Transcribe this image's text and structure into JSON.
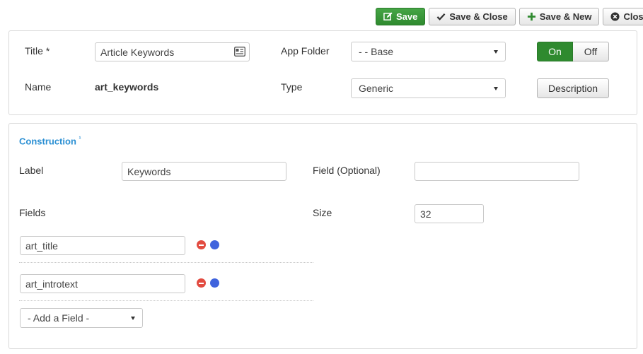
{
  "toolbar": {
    "save": "Save",
    "save_close": "Save & Close",
    "save_new": "Save & New",
    "close": "Close"
  },
  "details": {
    "title_label": "Title",
    "title_value": "Article Keywords",
    "name_label": "Name",
    "name_value": "art_keywords",
    "app_folder_label": "App Folder",
    "app_folder_value": "- - Base",
    "type_label": "Type",
    "type_value": "Generic",
    "toggle_on": "On",
    "toggle_off": "Off",
    "description_button": "Description"
  },
  "construction": {
    "title": "Construction",
    "title_marker": "¹",
    "label_label": "Label",
    "label_value": "Keywords",
    "field_optional_label": "Field (Optional)",
    "field_optional_value": "",
    "fields_label": "Fields",
    "size_label": "Size",
    "size_value": "32",
    "fields": [
      {
        "value": "art_title"
      },
      {
        "value": "art_introtext"
      }
    ],
    "add_field": "- Add a Field -"
  },
  "colors": {
    "accent_green": "#2f8a2f",
    "section_blue": "#2a8fd3",
    "remove_red": "#e24b40",
    "move_blue": "#3f63dd"
  }
}
